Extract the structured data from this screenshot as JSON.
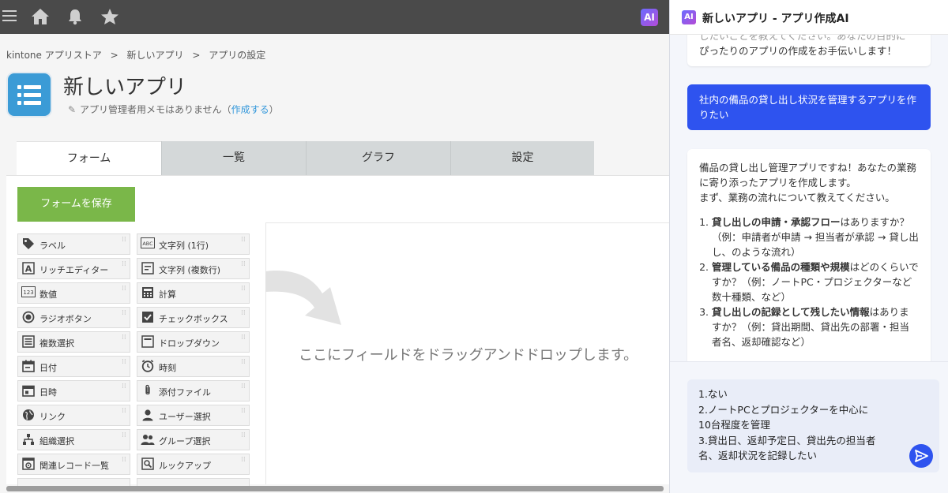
{
  "topbar": {
    "icons": [
      "menu-icon",
      "home-icon",
      "bell-icon",
      "star-icon"
    ],
    "ai_label": "AI"
  },
  "breadcrumb": [
    "kintone アプリストア",
    ">",
    "新しいアプリ",
    ">",
    "アプリの設定"
  ],
  "app": {
    "title": "新しいアプリ",
    "memo_text": "アプリ管理者用メモはありません（",
    "memo_link": "作成する",
    "memo_close": "）"
  },
  "tabs": [
    "フォーム",
    "一覧",
    "グラフ",
    "設定"
  ],
  "save_button": "フォームを保存",
  "palette": [
    {
      "label": "ラベル",
      "icon": "tag-icon"
    },
    {
      "label": "文字列 (1行)",
      "icon": "abc-icon"
    },
    {
      "label": "リッチエディター",
      "icon": "rich-editor-icon"
    },
    {
      "label": "文字列 (複数行)",
      "icon": "multiline-text-icon"
    },
    {
      "label": "数値",
      "icon": "number-icon"
    },
    {
      "label": "計算",
      "icon": "calculator-icon"
    },
    {
      "label": "ラジオボタン",
      "icon": "radio-icon"
    },
    {
      "label": "チェックボックス",
      "icon": "checkbox-icon"
    },
    {
      "label": "複数選択",
      "icon": "multi-select-icon"
    },
    {
      "label": "ドロップダウン",
      "icon": "dropdown-icon"
    },
    {
      "label": "日付",
      "icon": "calendar-icon"
    },
    {
      "label": "時刻",
      "icon": "clock-icon"
    },
    {
      "label": "日時",
      "icon": "datetime-icon"
    },
    {
      "label": "添付ファイル",
      "icon": "paperclip-icon"
    },
    {
      "label": "リンク",
      "icon": "globe-icon"
    },
    {
      "label": "ユーザー選択",
      "icon": "user-icon"
    },
    {
      "label": "組織選択",
      "icon": "org-icon"
    },
    {
      "label": "グループ選択",
      "icon": "group-icon"
    },
    {
      "label": "関連レコード一覧",
      "icon": "related-records-icon"
    },
    {
      "label": "ルックアップ",
      "icon": "lookup-icon"
    }
  ],
  "drop_zone_text": "ここにフィールドをドラッグアンドドロップします。",
  "ai_panel": {
    "title": "新しいアプリ - アプリ作成AI",
    "messages": {
      "ai_intro_line1": "したいことを教えてください。あなたの目的に",
      "ai_intro_line2": "ぴったりのアプリの作成をお手伝いします！",
      "user_request": "社内の備品の貸し出し状況を管理するアプリを作りたい",
      "ai_reply_p1": "備品の貸し出し管理アプリですね！あなたの業務に寄り添ったアプリを作成します。",
      "ai_reply_p2": "まず、業務の流れについて教えてください。",
      "q1_bold": "貸し出しの申請・承認フロー",
      "q1_rest": "はありますか？（例：申請者が申請 → 担当者が承認 → 貸し出し、のような流れ）",
      "q2_bold": "管理している備品の種類や規模",
      "q2_rest": "はどのくらいですか？（例：ノートPC・プロジェクターなど数十種類、など）",
      "q3_bold": "貸し出しの記録として残したい情報",
      "q3_rest": "はありますか？（例：貸出期間、貸出先の部署・担当者名、返却確認など）"
    },
    "input_value": "1.ない\n2.ノートPCとプロジェクターを中心に\n10台程度を管理\n3.貸出日、返却予定日、貸出先の担当者\n名、返却状況を記録したい"
  }
}
